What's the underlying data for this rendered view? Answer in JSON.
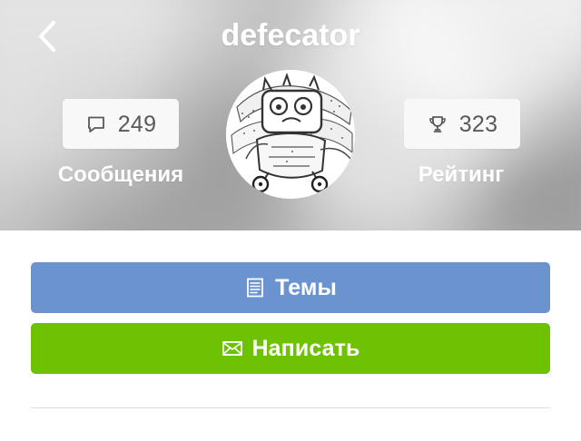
{
  "header": {
    "title": "defecator",
    "back_icon": "chevron-left-icon"
  },
  "stats": {
    "messages": {
      "value": "249",
      "label": "Сообщения",
      "icon": "speech-bubble-icon"
    },
    "rating": {
      "value": "323",
      "label": "Рейтинг",
      "icon": "trophy-icon"
    }
  },
  "buttons": {
    "themes": {
      "label": "Темы",
      "icon": "document-list-icon",
      "color": "#6b93cf"
    },
    "write": {
      "label": "Написать",
      "icon": "envelope-icon",
      "color": "#6fc103"
    }
  },
  "colors": {
    "hero_background": "#bdbdbd",
    "stat_text": "#595959",
    "divider": "#dddddd"
  }
}
